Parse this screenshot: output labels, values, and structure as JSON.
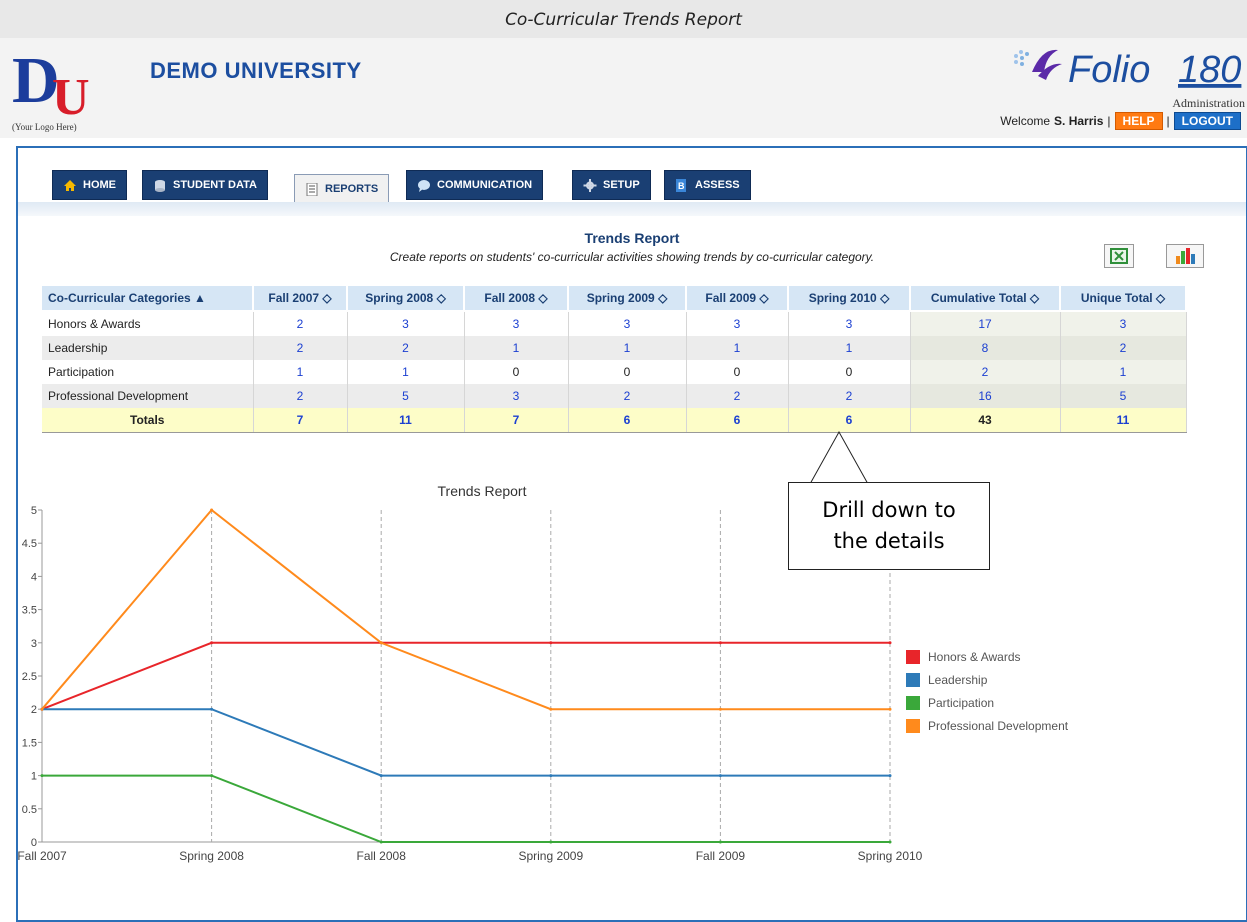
{
  "caption": "Co-Curricular Trends Report",
  "header": {
    "logo_letters": "DU",
    "logo_caption": "(Your Logo Here)",
    "university_name": "DEMO UNIVERSITY",
    "brand_name": "Folio",
    "brand_number": "180",
    "brand_sub": "Administration",
    "welcome_text": "Welcome",
    "user_name": "S. Harris",
    "separator": "|",
    "help_label": "HELP",
    "logout_label": "LOGOUT"
  },
  "tabs": [
    {
      "label": "HOME",
      "icon": "home-icon"
    },
    {
      "label": "STUDENT DATA",
      "icon": "database-icon"
    },
    {
      "label": "REPORTS",
      "icon": "report-icon",
      "active": true
    },
    {
      "label": "COMMUNICATION",
      "icon": "speech-bubble-icon"
    },
    {
      "label": "SETUP",
      "icon": "gear-icon"
    },
    {
      "label": "ASSESS",
      "icon": "assess-icon"
    }
  ],
  "report": {
    "title": "Trends Report",
    "subtitle": "Create reports on students' co-curricular activities showing trends by co-curricular category."
  },
  "table": {
    "headers": [
      "Co-Curricular Categories ▲",
      "Fall 2007 ◇",
      "Spring 2008 ◇",
      "Fall 2008 ◇",
      "Spring 2009 ◇",
      "Fall 2009 ◇",
      "Spring 2010 ◇",
      "Cumulative Total ◇",
      "Unique Total ◇"
    ],
    "rows": [
      [
        "Honors & Awards",
        "2",
        "3",
        "3",
        "3",
        "3",
        "3",
        "17",
        "3"
      ],
      [
        "Leadership",
        "2",
        "2",
        "1",
        "1",
        "1",
        "1",
        "8",
        "2"
      ],
      [
        "Participation",
        "1",
        "1",
        "0",
        "0",
        "0",
        "0",
        "2",
        "1"
      ],
      [
        "Professional Development",
        "2",
        "5",
        "3",
        "2",
        "2",
        "2",
        "16",
        "5"
      ]
    ],
    "totals": [
      "Totals",
      "7",
      "11",
      "7",
      "6",
      "6",
      "6",
      "43",
      "11"
    ]
  },
  "callout": {
    "line1": "Drill down to",
    "line2": "the details"
  },
  "colors": {
    "nav": "#1a3f73",
    "accent": "#2b6fb8",
    "link": "#1b3fd1",
    "help": "#ff7a12",
    "logout": "#1d6fc8"
  },
  "chart_data": {
    "type": "line",
    "title": "Trends Report",
    "categories": [
      "Fall 2007",
      "Spring 2008",
      "Fall 2008",
      "Spring 2009",
      "Fall 2009",
      "Spring 2010"
    ],
    "series": [
      {
        "name": "Honors & Awards",
        "values": [
          2,
          3,
          3,
          3,
          3,
          3
        ],
        "color": "#e8252a"
      },
      {
        "name": "Leadership",
        "values": [
          2,
          2,
          1,
          1,
          1,
          1
        ],
        "color": "#2d7ab8"
      },
      {
        "name": "Participation",
        "values": [
          1,
          1,
          0,
          0,
          0,
          0
        ],
        "color": "#3aa83a"
      },
      {
        "name": "Professional Development",
        "values": [
          2,
          5,
          3,
          2,
          2,
          2
        ],
        "color": "#ff8a1c"
      }
    ],
    "ylim": [
      0,
      5
    ],
    "yticks": [
      "0",
      "0.5",
      "1",
      "1.5",
      "2",
      "2.5",
      "3",
      "3.5",
      "4",
      "4.5",
      "5"
    ],
    "xlabel": "",
    "ylabel": "",
    "grid": "vertical dashed",
    "legend": "right"
  }
}
